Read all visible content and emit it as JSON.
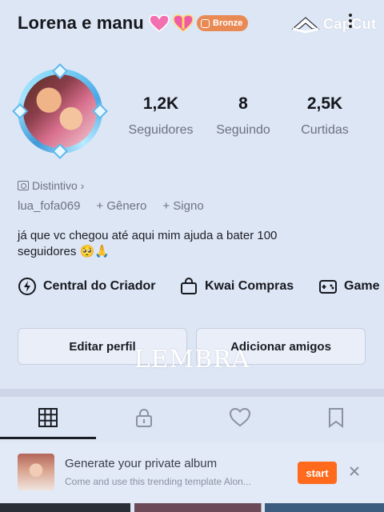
{
  "header": {
    "username": "Lorena e manu",
    "badge_label": "Bronze",
    "watermark": "CapCut"
  },
  "stats": [
    {
      "value": "1,2K",
      "label": "Seguidores"
    },
    {
      "value": "8",
      "label": "Seguindo"
    },
    {
      "value": "2,5K",
      "label": "Curtidas"
    }
  ],
  "profile": {
    "distintivo": "Distintivo ›",
    "handle": "lua_fofa069",
    "genero": "+ Gênero",
    "signo": "+ Signo",
    "bio": "já que vc chegou até aqui mim ajuda a bater 100 seguidores 🥺🙏"
  },
  "quick_actions": [
    {
      "label": "Central do Criador",
      "icon": "lightning-icon"
    },
    {
      "label": "Kwai Compras",
      "icon": "shopping-bag-icon"
    },
    {
      "label": "Game",
      "icon": "gamepad-icon"
    }
  ],
  "buttons": {
    "edit": "Editar perfil",
    "add_friends": "Adicionar amigos"
  },
  "overlay_text": "LEMBRA",
  "tabs": [
    {
      "name": "grid-icon",
      "active": true
    },
    {
      "name": "lock-icon",
      "active": false
    },
    {
      "name": "heart-icon",
      "active": false
    },
    {
      "name": "bookmark-icon",
      "active": false
    }
  ],
  "banner": {
    "title": "Generate your private album",
    "subtitle": "Come and use this trending template Alon...",
    "start": "start"
  },
  "colors": {
    "background": "#dde6f5",
    "accent": "#ff6a1c",
    "badge": "#e98a55"
  }
}
